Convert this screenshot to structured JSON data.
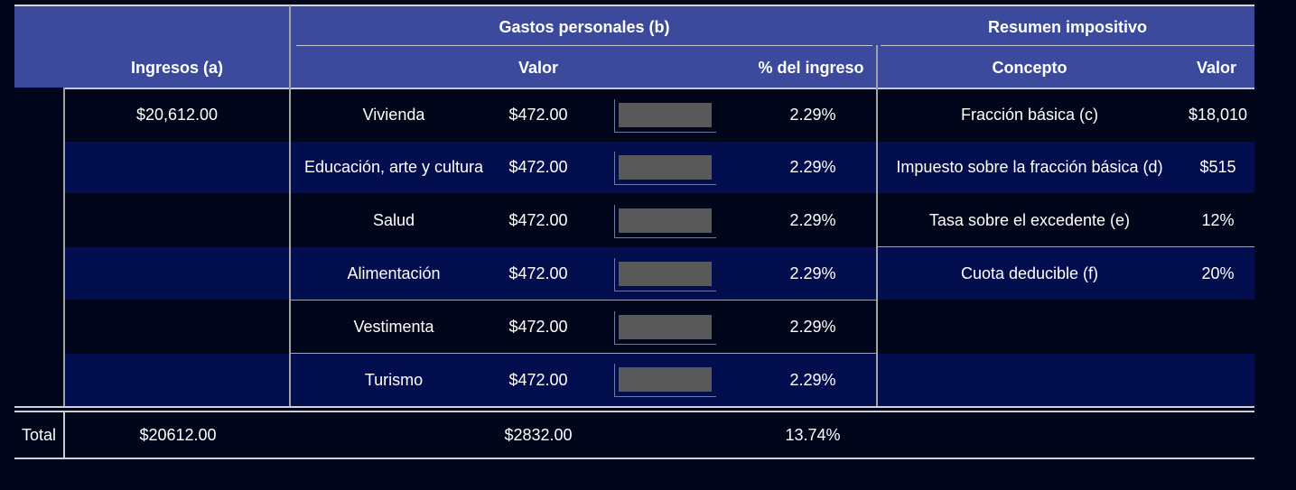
{
  "header": {
    "ingresos": "Ingresos (a)",
    "gastos_group": "Gastos personales (b)",
    "valor": "Valor",
    "pct": "% del ingreso",
    "resumen_group": "Resumen impositivo",
    "concepto": "Concepto",
    "valor_resumen": "Valor"
  },
  "ingreso": "$20,612.00",
  "gastos": [
    {
      "name": "Vivienda",
      "value": "$472.00",
      "pct": "2.29%"
    },
    {
      "name": "Educación, arte y cultura",
      "value": "$472.00",
      "pct": "2.29%"
    },
    {
      "name": "Salud",
      "value": "$472.00",
      "pct": "2.29%"
    },
    {
      "name": "Alimentación",
      "value": "$472.00",
      "pct": "2.29%"
    },
    {
      "name": "Vestimenta",
      "value": "$472.00",
      "pct": "2.29%"
    },
    {
      "name": "Turismo",
      "value": "$472.00",
      "pct": "2.29%"
    }
  ],
  "resumen": [
    {
      "concepto": "Fracción básica (c)",
      "valor": "$18,010"
    },
    {
      "concepto": "Impuesto sobre la fracción básica (d)",
      "valor": "$515"
    },
    {
      "concepto": "Tasa sobre el excedente (e)",
      "valor": "12%"
    },
    {
      "concepto": "Cuota deducible (f)",
      "valor": "20%"
    }
  ],
  "total": {
    "label": "Total",
    "ingresos": "$20612.00",
    "gastos": "$2832.00",
    "pct": "13.74%"
  },
  "colors": {
    "header_bg": "#3c4a9e",
    "row_blue": "#030e4f",
    "row_dark": "#02061a",
    "bar": "#595959"
  }
}
